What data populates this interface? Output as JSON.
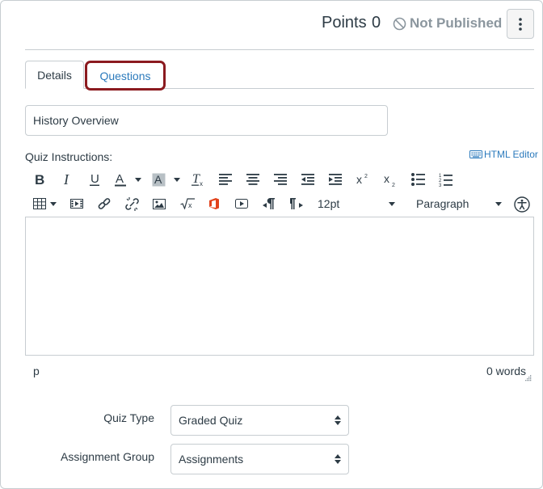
{
  "header": {
    "points_label": "Points",
    "points_value": "0",
    "publish_status": "Not Published"
  },
  "tabs": [
    {
      "label": "Details",
      "active": true
    },
    {
      "label": "Questions",
      "active": false,
      "highlighted": true
    }
  ],
  "quiz": {
    "title": "History Overview"
  },
  "instructions": {
    "label": "Quiz Instructions:",
    "html_editor_link": "HTML Editor",
    "font_size": "12pt",
    "block_format": "Paragraph",
    "status_path": "p",
    "word_count": "0 words"
  },
  "toolbar_icons": [
    "bold-icon",
    "italic-icon",
    "underline-icon",
    "text-color-icon",
    "background-color-icon",
    "clear-formatting-icon",
    "align-left-icon",
    "align-center-icon",
    "align-right-icon",
    "outdent-icon",
    "indent-icon",
    "superscript-icon",
    "subscript-icon",
    "bullet-list-icon",
    "numbered-list-icon",
    "table-icon",
    "media-icon",
    "link-icon",
    "unlink-icon",
    "image-icon",
    "equation-icon",
    "office-icon",
    "video-icon",
    "ltr-icon",
    "rtl-icon",
    "accessibility-icon"
  ],
  "settings": {
    "quiz_type_label": "Quiz Type",
    "quiz_type_value": "Graded Quiz",
    "assignment_group_label": "Assignment Group",
    "assignment_group_value": "Assignments"
  },
  "colors": {
    "link": "#2b7abc",
    "highlight_border": "#8b1a1f",
    "text": "#2d3b45",
    "muted": "#8b969e",
    "border": "#c7cdd1"
  }
}
